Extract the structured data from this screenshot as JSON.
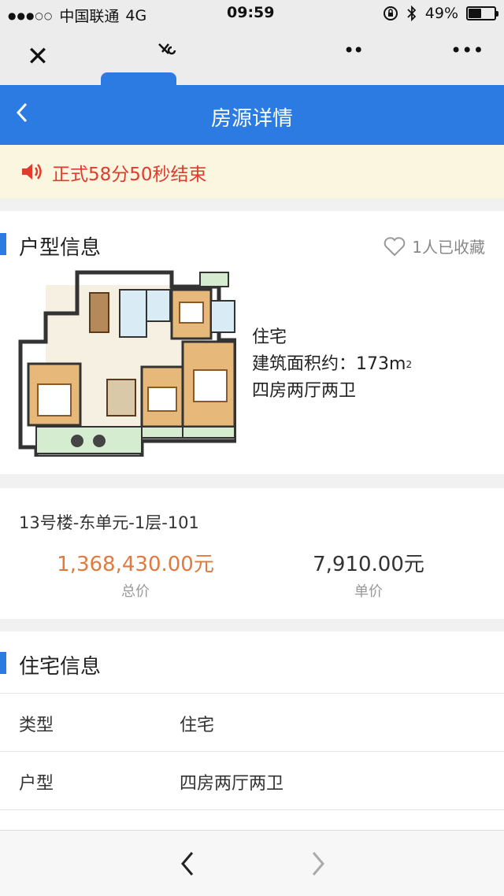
{
  "statusbar": {
    "carrier": "中国联通",
    "network": "4G",
    "time": "09:59",
    "battery": "49%",
    "battery_level": 0.49
  },
  "wechat_bar": {
    "close_icon": "close-icon",
    "more_icon": "more-dots-icon"
  },
  "navbar": {
    "title": "房源详情"
  },
  "notice": {
    "text": "正式58分50秒结束",
    "color": "#e13b2e"
  },
  "layout_section": {
    "title": "户型信息",
    "favorites": "1人已收藏",
    "property_type": "住宅",
    "area_label": "建筑面积约：",
    "area_value": "173m",
    "area_unit_sup": "2",
    "rooms": "四房两厅两卫"
  },
  "unit": {
    "address": "13号楼-东单元-1层-101",
    "total_price": "1,368,430.00元",
    "total_label": "总价",
    "unit_price": "7,910.00元",
    "unit_label": "单价",
    "total_color": "#e07a3f"
  },
  "residence_section": {
    "title": "住宅信息",
    "rows": [
      {
        "key": "类型",
        "value": "住宅"
      },
      {
        "key": "户型",
        "value": "四房两厅两卫"
      }
    ]
  },
  "colors": {
    "accent": "#2c7be3"
  }
}
